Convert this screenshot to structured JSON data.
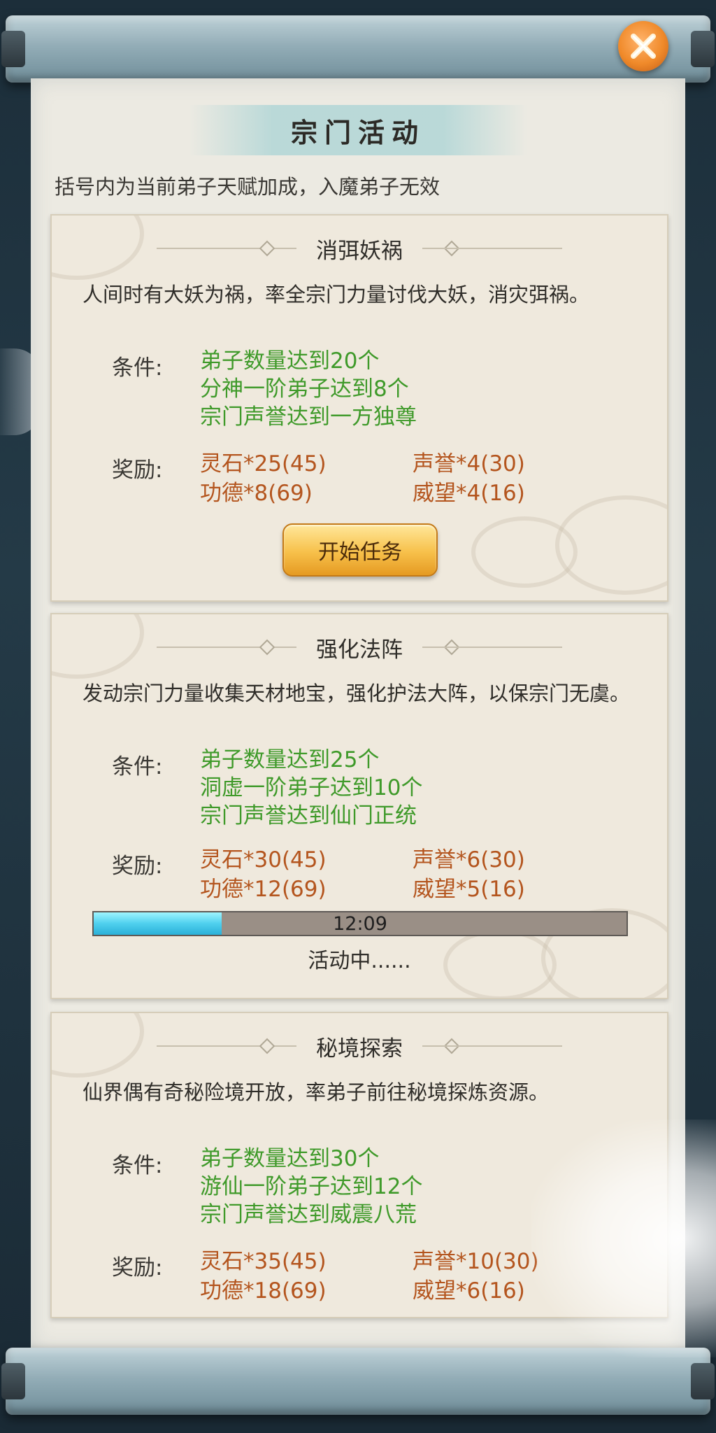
{
  "window": {
    "title": "宗门活动"
  },
  "subtitle": "括号内为当前弟子天赋加成，入魔弟子无效",
  "labels": {
    "conditions": "条件:",
    "rewards": "奖励:"
  },
  "close_icon": "close-x-icon",
  "activities": [
    {
      "title": "消弭妖祸",
      "description": "人间时有大妖为祸，率全宗门力量讨伐大妖，消灾弭祸。",
      "conditions": [
        "弟子数量达到20个",
        "分神一阶弟子达到8个",
        "宗门声誉达到一方独尊"
      ],
      "rewards": [
        "灵石*25(45)",
        "声誉*4(30)",
        "功德*8(69)",
        "威望*4(16)"
      ],
      "button_label": "开始任务"
    },
    {
      "title": "强化法阵",
      "description": "发动宗门力量收集天材地宝，强化护法大阵，以保宗门无虞。",
      "conditions": [
        "弟子数量达到25个",
        "洞虚一阶弟子达到10个",
        "宗门声誉达到仙门正统"
      ],
      "rewards": [
        "灵石*30(45)",
        "声誉*6(30)",
        "功德*12(69)",
        "威望*5(16)"
      ],
      "progress": {
        "time": "12:09",
        "fraction": 0.24
      },
      "status": "活动中......"
    },
    {
      "title": "秘境探索",
      "description": "仙界偶有奇秘险境开放，率弟子前往秘境探炼资源。",
      "conditions": [
        "弟子数量达到30个",
        "游仙一阶弟子达到12个",
        "宗门声誉达到威震八荒"
      ],
      "rewards": [
        "灵石*35(45)",
        "声誉*10(30)",
        "功德*18(69)",
        "威望*6(16)"
      ]
    }
  ],
  "colors": {
    "condition_text": "#3f9a2a",
    "reward_text": "#b4551e",
    "button_gold": "#f7c04a",
    "progress_fill": "#4fd0ee"
  }
}
